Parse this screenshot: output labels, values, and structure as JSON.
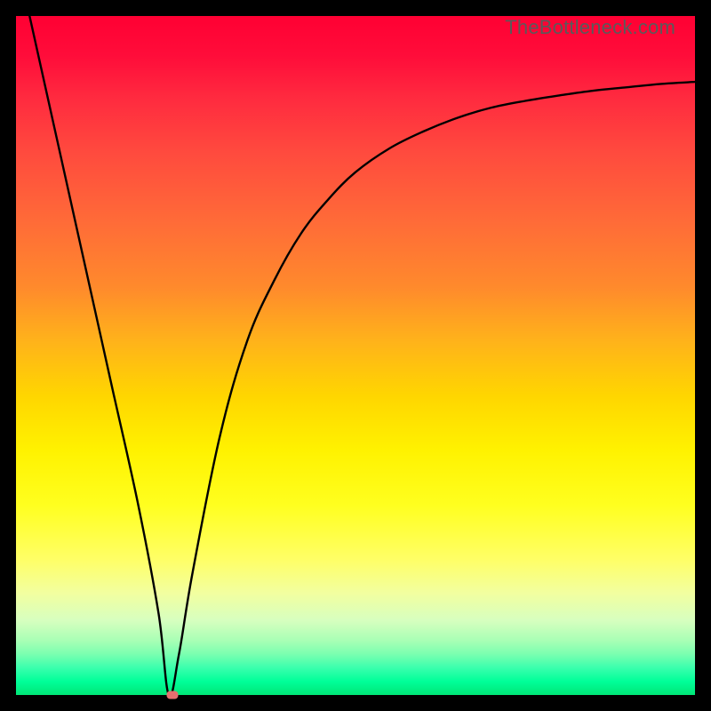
{
  "watermark": "TheBottleneck.com",
  "chart_data": {
    "type": "line",
    "title": "",
    "xlabel": "",
    "ylabel": "",
    "xlim": [
      0,
      100
    ],
    "ylim": [
      0,
      100
    ],
    "grid": false,
    "series": [
      {
        "name": "curve",
        "color": "#000000",
        "x": [
          2,
          6,
          10,
          14,
          18,
          21,
          22.5,
          24,
          26,
          30,
          34,
          38,
          42,
          46,
          50,
          55,
          60,
          65,
          70,
          75,
          80,
          85,
          90,
          95,
          100
        ],
        "y": [
          100,
          82,
          64,
          46,
          28,
          12,
          0,
          6,
          18,
          38,
          52,
          61,
          68,
          73,
          77,
          80.5,
          83,
          85,
          86.5,
          87.5,
          88.3,
          89,
          89.5,
          90,
          90.3
        ]
      }
    ],
    "marker": {
      "x": 23,
      "y": 0,
      "note": "minimum"
    }
  },
  "layout": {
    "plot": {
      "left": 18,
      "top": 18,
      "size": 764
    }
  }
}
